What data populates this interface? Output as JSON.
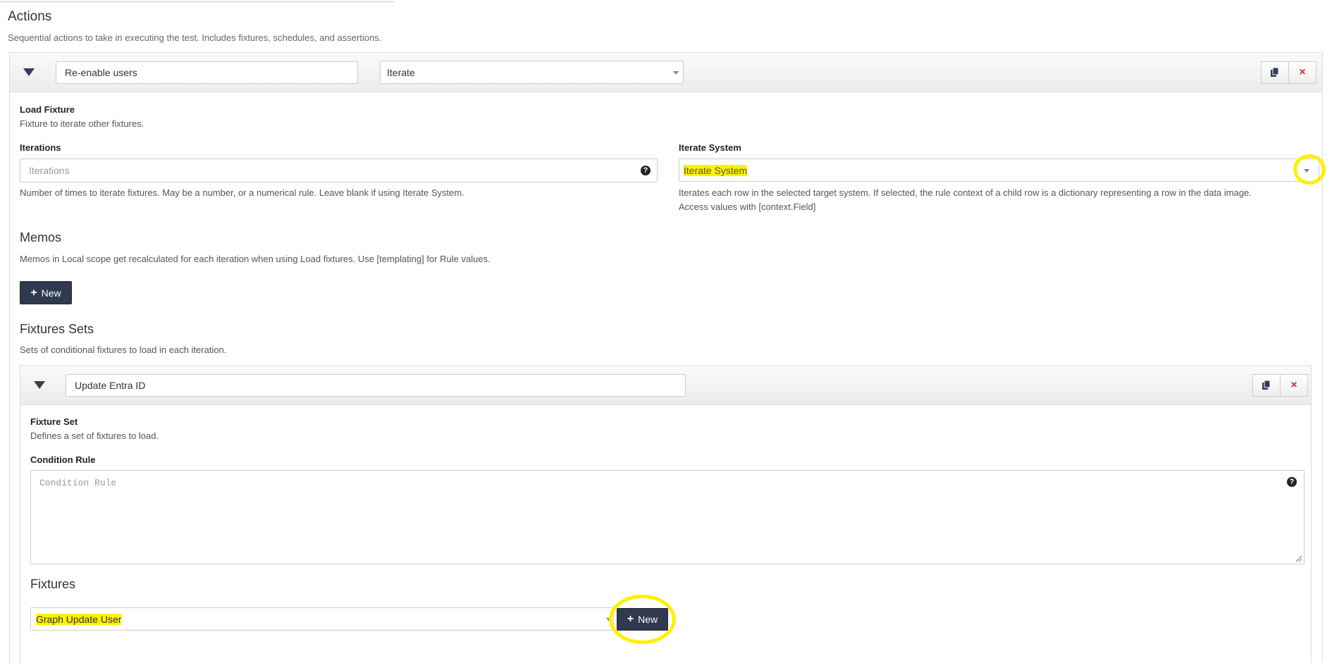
{
  "actions": {
    "title": "Actions",
    "description": "Sequential actions to take in executing the test. Includes fixtures, schedules, and assertions."
  },
  "action": {
    "name_value": "Re-enable users",
    "type_value": "Iterate",
    "fixture_title": "Load Fixture",
    "fixture_desc": "Fixture to iterate other fixtures.",
    "iterations_label": "Iterations",
    "iterations_placeholder": "Iterations",
    "iterations_help": "Number of times to iterate fixtures. May be a number, or a numerical rule. Leave blank if using Iterate System.",
    "iterate_system_label": "Iterate System",
    "iterate_system_value": "Iterate System",
    "iterate_system_help_1": "Iterates each row in the selected target system. If selected, the rule context of a child row is a dictionary representing a row in the data image.",
    "iterate_system_help_2": "Access values with [context.Field]",
    "help_glyph": "?"
  },
  "memos": {
    "title": "Memos",
    "description": "Memos in Local scope get recalculated for each iteration when using Load fixtures. Use [templating] for Rule values.",
    "new_label": "New"
  },
  "fixture_sets": {
    "title": "Fixtures Sets",
    "description": "Sets of conditional fixtures to load in each iteration.",
    "set": {
      "name_value": "Update Entra ID",
      "title": "Fixture Set",
      "desc": "Defines a set of fixtures to load.",
      "condition_label": "Condition Rule",
      "condition_placeholder": "Condition Rule",
      "fixtures_title": "Fixtures",
      "fixture_select_value": "Graph Update User",
      "new_label": "New"
    }
  },
  "icons": {
    "plus": "+",
    "close": "×",
    "copy": "copy-icon",
    "collapse": "triangle-down-icon"
  },
  "colors": {
    "highlight": "#fff200",
    "button_dark": "#2f3a4f",
    "danger": "#c9302c"
  }
}
